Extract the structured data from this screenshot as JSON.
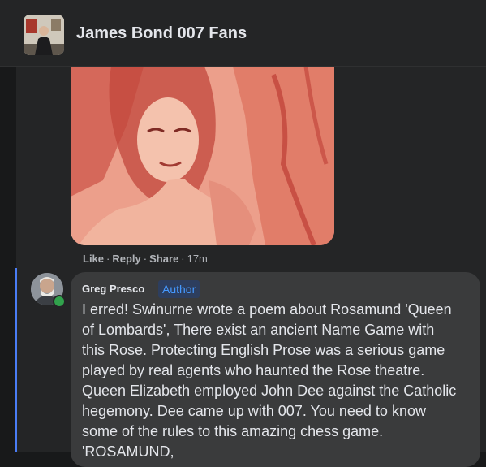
{
  "header": {
    "group_name": "James Bond 007 Fans"
  },
  "post": {
    "actions": {
      "like": "Like",
      "reply": "Reply",
      "share": "Share",
      "separator": "·",
      "time": "17m"
    }
  },
  "comment": {
    "author": "Greg Presco",
    "badge": "Author",
    "lines": [
      "I erred! Swinurne wrote a poem about Rosamund 'Queen",
      "of Lombards', There exist an ancient Name Game with",
      "this Rose. Protecting English Prose was a serious game",
      "played by real agents who haunted the Rose theatre.",
      "Queen Elizabeth employed John Dee against the Catholic",
      "hegemony. Dee came up with 007. You need to know",
      "some of the rules to this amazing chess game.",
      "'ROSAMUND,"
    ]
  },
  "colors": {
    "background": "#18191a",
    "surface": "#242526",
    "bubble": "#3a3b3c",
    "accent": "#4599ff",
    "online": "#31a24c"
  }
}
